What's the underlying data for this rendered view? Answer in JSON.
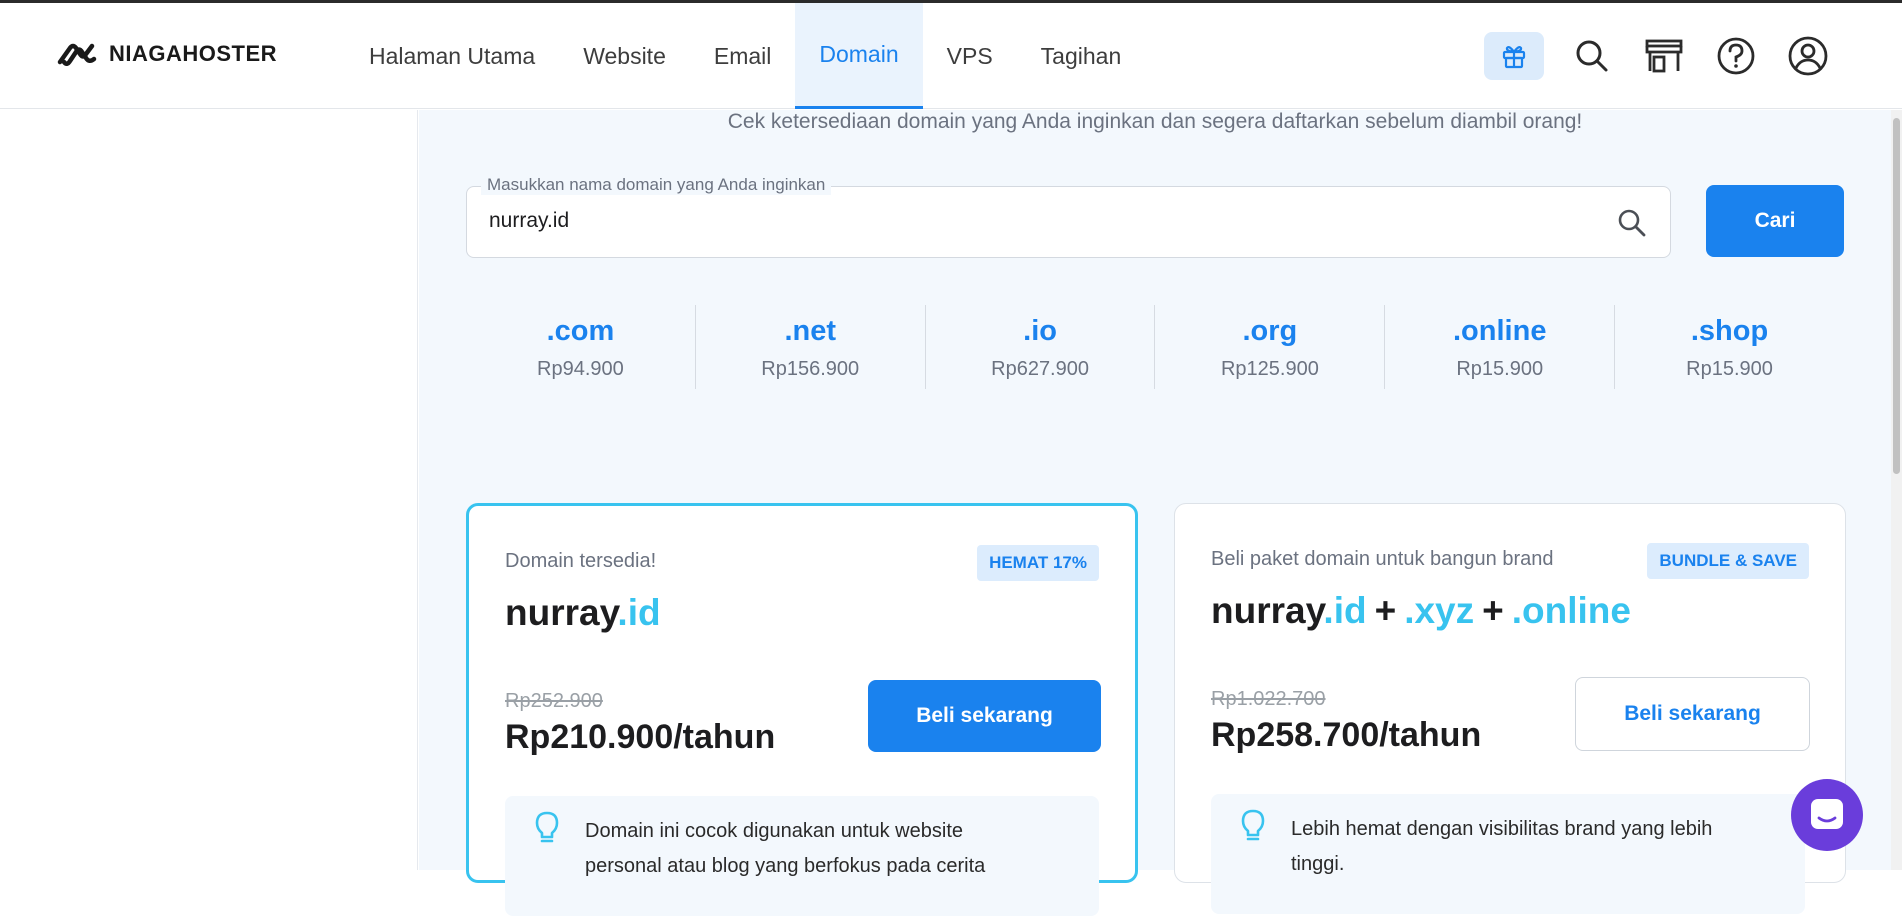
{
  "brand": {
    "name": "NIAGAHOSTER"
  },
  "nav": {
    "items": [
      {
        "label": "Halaman Utama",
        "active": false
      },
      {
        "label": "Website",
        "active": false
      },
      {
        "label": "Email",
        "active": false
      },
      {
        "label": "Domain",
        "active": true
      },
      {
        "label": "VPS",
        "active": false
      },
      {
        "label": "Tagihan",
        "active": false
      }
    ]
  },
  "header_icons": [
    "gift-icon",
    "search-icon",
    "store-icon",
    "help-icon",
    "account-icon"
  ],
  "main": {
    "subtitle": "Cek ketersediaan domain yang Anda inginkan dan segera daftarkan sebelum diambil orang!",
    "search": {
      "label": "Masukkan nama domain yang Anda inginkan",
      "value": "nurray.id",
      "button": "Cari"
    },
    "tlds": [
      {
        "name": ".com",
        "price": "Rp94.900"
      },
      {
        "name": ".net",
        "price": "Rp156.900"
      },
      {
        "name": ".io",
        "price": "Rp627.900"
      },
      {
        "name": ".org",
        "price": "Rp125.900"
      },
      {
        "name": ".online",
        "price": "Rp15.900"
      },
      {
        "name": ".shop",
        "price": "Rp15.900"
      }
    ],
    "card1": {
      "label": "Domain tersedia!",
      "badge": "HEMAT 17%",
      "domain_name": "nurray",
      "domain_ext": ".id",
      "old_price": "Rp252.900",
      "price": "Rp210.900/tahun",
      "button": "Beli sekarang",
      "tip": "Domain ini cocok digunakan untuk website personal atau blog yang berfokus pada cerita"
    },
    "card2": {
      "label": "Beli paket domain untuk bangun brand",
      "badge": "BUNDLE & SAVE",
      "domain_name": "nurray",
      "ext1": ".id",
      "ext2": ".xyz",
      "ext3": ".online",
      "plus": "+",
      "old_price": "Rp1.022.700",
      "price": "Rp258.700/tahun",
      "button": "Beli sekarang",
      "tip": "Lebih hemat dengan visibilitas brand yang lebih tinggi."
    }
  },
  "colors": {
    "primary": "#1a82ee",
    "accent": "#38c3ef",
    "chat": "#6a3ddb",
    "page_bg": "#f3f8fd"
  }
}
